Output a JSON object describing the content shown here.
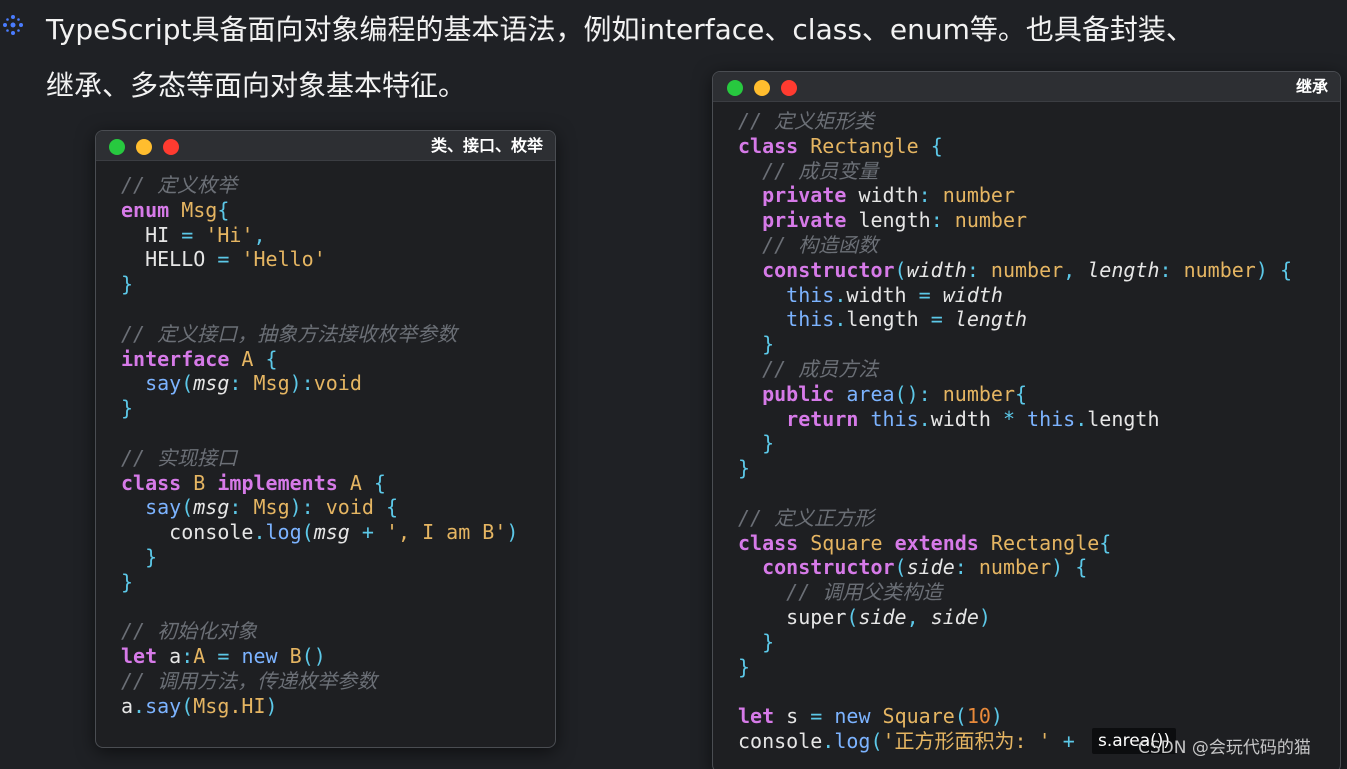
{
  "intro": {
    "line1": "TypeScript具备面向对象编程的基本语法，例如interface、class、enum等。也具备封装、",
    "line2": "继承、多态等面向对象基本特征。",
    "bullet_icon": "sparkle-bullet-icon"
  },
  "colors": {
    "background": "#1f2125",
    "keyword": "#d67ae8",
    "type": "#e5b562",
    "comment": "#6b6f76",
    "function": "#7cb3ff",
    "punctuation": "#5cc8e8",
    "number": "#e8893a"
  },
  "window_class": {
    "title": "类、接口、枚举",
    "code": {
      "l1": "// 定义枚举",
      "l2_kw": "enum",
      "l2_name": "Msg",
      "l3_key": "HI",
      "l3_val": "'Hi'",
      "l4_key": "HELLO",
      "l4_val": "'Hello'",
      "l7": "// 定义接口，抽象方法接收枚举参数",
      "l8_kw": "interface",
      "l8_name": "A",
      "l9_fn": "say",
      "l9_param": "msg",
      "l9_type": "Msg",
      "l9_ret": "void",
      "l12": "// 实现接口",
      "l13_kw": "class",
      "l13_name": "B",
      "l13_impl": "implements",
      "l13_iface": "A",
      "l14_fn": "say",
      "l14_param": "msg",
      "l14_type": "Msg",
      "l14_ret": "void",
      "l15_obj": "console",
      "l15_fn": "log",
      "l15_param": "msg",
      "l15_str": "', I am B'",
      "l19": "// 初始化对象",
      "l20_kw": "let",
      "l20_var": "a",
      "l20_type": "A",
      "l20_new": "new",
      "l20_cls": "B",
      "l21": "// 调用方法，传递枚举参数",
      "l22_obj": "a",
      "l22_fn": "say",
      "l22_arg": "Msg.HI"
    }
  },
  "window_inherit": {
    "title": "继承",
    "code": {
      "l1": "// 定义矩形类",
      "l2_kw": "class",
      "l2_name": "Rectangle",
      "l3": "// 成员变量",
      "l4_kw": "private",
      "l4_field": "width",
      "l4_type": "number",
      "l5_kw": "private",
      "l5_field": "length",
      "l5_type": "number",
      "l6": "// 构造函数",
      "l7_kw": "constructor",
      "l7_p1": "width",
      "l7_t1": "number",
      "l7_p2": "length",
      "l7_t2": "number",
      "l8_this": "this",
      "l8_field": "width",
      "l8_val": "width",
      "l9_this": "this",
      "l9_field": "length",
      "l9_val": "length",
      "l11": "// 成员方法",
      "l12_kw": "public",
      "l12_fn": "area",
      "l12_type": "number",
      "l13_kw": "return",
      "l13_this1": "this",
      "l13_f1": "width",
      "l13_this2": "this",
      "l13_f2": "length",
      "l17": "// 定义正方形",
      "l18_kw": "class",
      "l18_name": "Square",
      "l18_ext": "extends",
      "l18_parent": "Rectangle",
      "l19_kw": "constructor",
      "l19_p": "side",
      "l19_t": "number",
      "l20": "// 调用父类构造",
      "l21_fn": "super",
      "l21_a1": "side",
      "l21_a2": "side",
      "l25_kw": "let",
      "l25_var": "s",
      "l25_new": "new",
      "l25_cls": "Square",
      "l25_num": "10",
      "l26_obj": "console",
      "l26_fn": "log",
      "l26_str": "'正方形面积为: '",
      "l26_op": "+"
    }
  },
  "overlay": {
    "call_text": "s.area())",
    "watermark": "CSDN @会玩代码的猫"
  }
}
